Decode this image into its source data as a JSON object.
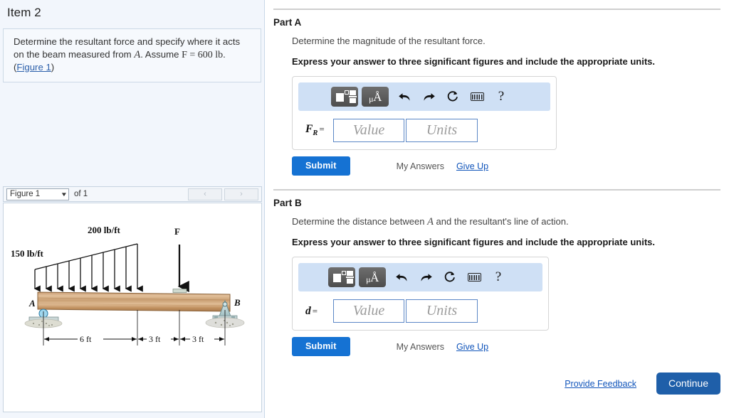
{
  "item": {
    "title": "Item 2",
    "problem_line1": "Determine the resultant force and specify where it acts",
    "problem_line2_a": "on the beam measured from ",
    "problem_var_A": "A",
    "problem_line2_b": ". Assume ",
    "problem_force_expr": "F = 600 lb",
    "problem_line2_c": ".",
    "figure_link_open": "(",
    "figure_link": "Figure 1",
    "figure_link_close": ")"
  },
  "figure_bar": {
    "selected": "Figure 1",
    "caret": "▼",
    "of_label": "of 1",
    "prev": "‹",
    "next": "›"
  },
  "figure": {
    "label_left_load": "150 lb/ft",
    "label_right_load": "200 lb/ft",
    "label_force": "F",
    "label_A": "A",
    "label_B": "B",
    "dim1": "6 ft",
    "dim2": "3 ft",
    "dim3": "3 ft"
  },
  "toolbar": {
    "template_icon": "template-icon",
    "units_mu": "μ",
    "units_A": "Å",
    "undo_icon": "undo-icon",
    "redo_icon": "redo-icon",
    "reset_icon": "reset-icon",
    "keyboard_icon": "keyboard-icon",
    "help": "?"
  },
  "part_a": {
    "heading": "Part A",
    "prompt": "Determine the magnitude of the resultant force.",
    "instruction": "Express your answer to three significant figures and include the appropriate units.",
    "var_symbol": "F",
    "var_subscript": "R",
    "equals": "=",
    "value_placeholder": "Value",
    "units_placeholder": "Units",
    "submit_label": "Submit",
    "my_answers_label": "My Answers",
    "give_up_label": "Give Up"
  },
  "part_b": {
    "heading": "Part B",
    "prompt_a": "Determine the distance between ",
    "prompt_var": "A",
    "prompt_b": " and the resultant's line of action.",
    "instruction": "Express your answer to three significant figures and include the appropriate units.",
    "var_symbol": "d",
    "equals": "=",
    "value_placeholder": "Value",
    "units_placeholder": "Units",
    "submit_label": "Submit",
    "my_answers_label": "My Answers",
    "give_up_label": "Give Up"
  },
  "footer": {
    "provide_feedback": "Provide Feedback",
    "continue_label": "Continue"
  },
  "colors": {
    "sidebar_bg": "#f2f6fc",
    "submit_blue": "#1572d3",
    "continue_blue": "#1f5fa9",
    "link_blue": "#1155bb",
    "mathbar_blue": "#cfe0f5",
    "field_border": "#5b87c6"
  }
}
